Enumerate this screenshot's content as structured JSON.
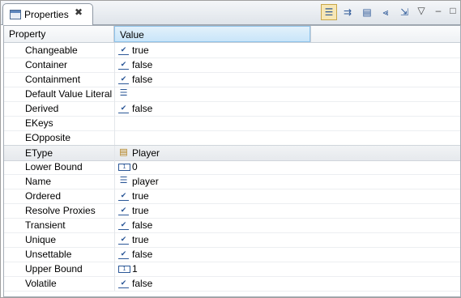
{
  "tab": {
    "label": "Properties",
    "close": "✖"
  },
  "toolbar": {
    "buttons": [
      {
        "name": "categories-icon",
        "glyph": "☰"
      },
      {
        "name": "filter-advanced-icon",
        "glyph": "⇉"
      },
      {
        "name": "restore-default-icon",
        "glyph": "▤"
      },
      {
        "name": "collapse-icon",
        "glyph": "⪡"
      },
      {
        "name": "pin-icon",
        "glyph": "⇲"
      },
      {
        "name": "view-menu-icon",
        "glyph": "▽"
      },
      {
        "name": "minimize-icon",
        "glyph": "–"
      },
      {
        "name": "maximize-icon",
        "glyph": "□"
      }
    ]
  },
  "table": {
    "columns": [
      "Property",
      "Value"
    ],
    "rows": [
      {
        "property": "Changeable",
        "icon": "bool",
        "value": "true"
      },
      {
        "property": "Container",
        "icon": "bool",
        "value": "false"
      },
      {
        "property": "Containment",
        "icon": "bool",
        "value": "false"
      },
      {
        "property": "Default Value Literal",
        "icon": "list",
        "value": ""
      },
      {
        "property": "Derived",
        "icon": "bool",
        "value": "false"
      },
      {
        "property": "EKeys",
        "icon": "",
        "value": ""
      },
      {
        "property": "EOpposite",
        "icon": "",
        "value": ""
      },
      {
        "property": "EType",
        "icon": "class",
        "value": "Player",
        "selected": true
      },
      {
        "property": "Lower Bound",
        "icon": "int",
        "value": "0"
      },
      {
        "property": "Name",
        "icon": "list",
        "value": "player"
      },
      {
        "property": "Ordered",
        "icon": "bool",
        "value": "true"
      },
      {
        "property": "Resolve Proxies",
        "icon": "bool",
        "value": "true"
      },
      {
        "property": "Transient",
        "icon": "bool",
        "value": "false"
      },
      {
        "property": "Unique",
        "icon": "bool",
        "value": "true"
      },
      {
        "property": "Unsettable",
        "icon": "bool",
        "value": "false"
      },
      {
        "property": "Upper Bound",
        "icon": "int",
        "value": "1"
      },
      {
        "property": "Volatile",
        "icon": "bool",
        "value": "false"
      }
    ]
  }
}
